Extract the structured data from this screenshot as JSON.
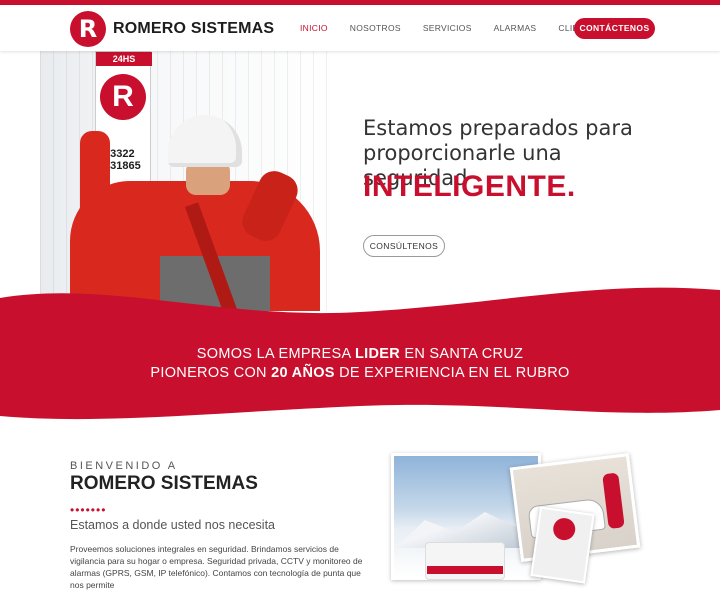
{
  "brand": {
    "name": "ROMERO SISTEMAS",
    "mark": "R",
    "accent": "#c8102e"
  },
  "nav": {
    "items": [
      {
        "label": "INICIO",
        "active": true
      },
      {
        "label": "NOSOTROS",
        "active": false
      },
      {
        "label": "SERVICIOS",
        "active": false
      },
      {
        "label": "ALARMAS",
        "active": false
      },
      {
        "label": "CLIENTES",
        "active": false
      }
    ],
    "cta_label": "CONTÁCTENOS"
  },
  "hero": {
    "sign_header": "24HS",
    "sign_mark": "R",
    "sign_number_1": "33322",
    "sign_number_2": "431865",
    "headline_line1": "Estamos preparados para",
    "headline_line2": "proporcionarle una seguridad",
    "headline_emphasis": "INTELIGENTE.",
    "button_label": "CONSÚLTENOS"
  },
  "band": {
    "line1_pre": "SOMOS LA EMPRESA ",
    "line1_bold": "LIDER",
    "line1_post": " EN SANTA CRUZ",
    "line2_pre": "PIONEROS CON ",
    "line2_bold": "20 AÑOS",
    "line2_post": " DE EXPERIENCIA EN EL RUBRO",
    "color": "#c8102e"
  },
  "about": {
    "welcome": "BIENVENIDO A",
    "company": "ROMERO SISTEMAS",
    "dots": "•••••••",
    "tagline": "Estamos a donde usted nos necesita",
    "body": "Proveemos soluciones integrales en seguridad. Brindamos servicios de vigilancia para su hogar o empresa. Seguridad privada, CCTV y monitoreo de alarmas (GPRS, GSM, IP telefónico). Contamos con tecnología de punta que nos permite"
  }
}
